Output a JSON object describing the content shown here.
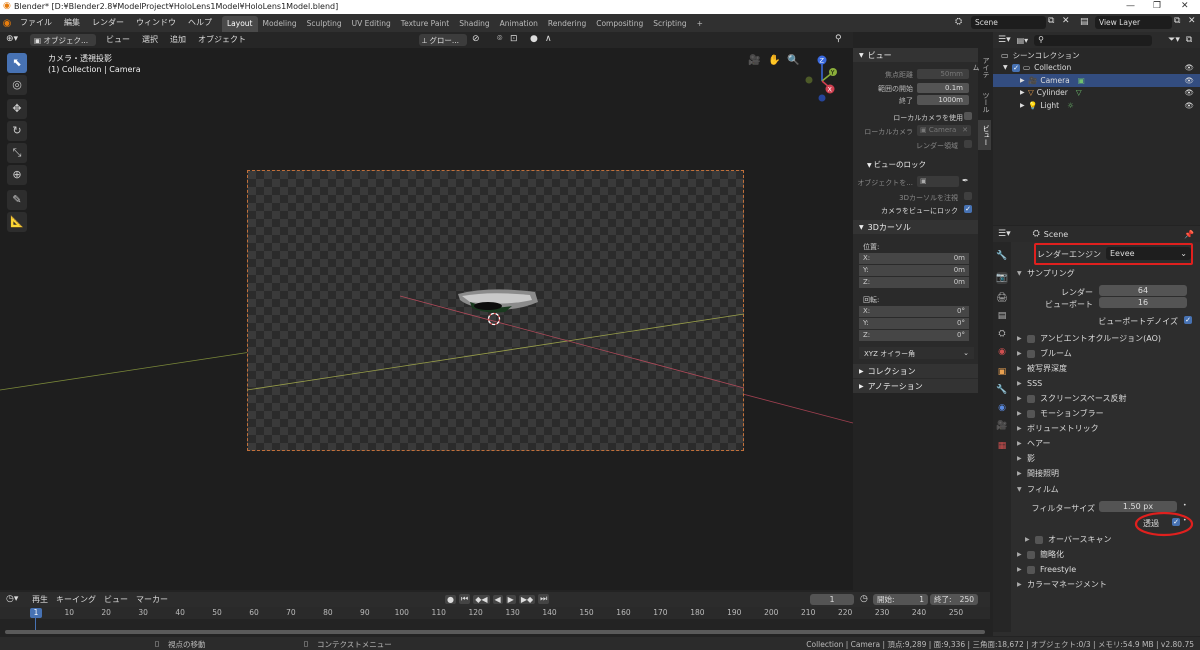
{
  "window": {
    "title": "Blender* [D:¥Blender2.8¥ModelProject¥HoloLens1Model¥HoloLens1Model.blend]"
  },
  "menubar": [
    "ファイル",
    "編集",
    "レンダー",
    "ウィンドウ",
    "ヘルプ"
  ],
  "workspaces": [
    "Layout",
    "Modeling",
    "Sculpting",
    "UV Editing",
    "Texture Paint",
    "Shading",
    "Animation",
    "Rendering",
    "Compositing",
    "Scripting",
    "+"
  ],
  "scene": {
    "name": "Scene",
    "view_layer": "View Layer"
  },
  "viewport_header": {
    "mode": "オブジェク...",
    "menus": [
      "ビュー",
      "選択",
      "追加",
      "オブジェクト"
    ],
    "orientation": "グロー..."
  },
  "viewport": {
    "overlay_line1": "カメラ・透視投影",
    "overlay_line2": "(1) Collection | Camera"
  },
  "npanel": {
    "view_title": "ビュー",
    "focal_label": "焦点距離",
    "focal_value": "50mm",
    "clip_start_label": "範囲の開始",
    "clip_start_value": "0.1m",
    "clip_end_label": "終了",
    "clip_end_value": "1000m",
    "local_camera_use": "ローカルカメラを使用",
    "local_camera_label": "ローカルカメラ",
    "local_camera_value": "Camera",
    "render_region": "レンダー領域",
    "view_lock_title": "ビューのロック",
    "lock_object_label": "オブジェクトを...",
    "lock_3d_cursor": "3Dカーソルを注視",
    "lock_camera_to_view": "カメラをビューにロック",
    "cursor_title": "3Dカーソル",
    "location_label": "位置:",
    "loc": [
      {
        "axis": "X:",
        "value": "0m"
      },
      {
        "axis": "Y:",
        "value": "0m"
      },
      {
        "axis": "Z:",
        "value": "0m"
      }
    ],
    "rotation_label": "回転:",
    "rot": [
      {
        "axis": "X:",
        "value": "0°"
      },
      {
        "axis": "Y:",
        "value": "0°"
      },
      {
        "axis": "Z:",
        "value": "0°"
      }
    ],
    "rotation_mode": "XYZ オイラー角",
    "collection_title": "コレクション",
    "annotation_title": "アノテーション"
  },
  "vtabs": [
    "アイテム",
    "ツール",
    "ビュー"
  ],
  "outliner": {
    "root": "シーンコレクション",
    "collection": "Collection",
    "items": [
      "Camera",
      "Cylinder",
      "Light"
    ]
  },
  "properties": {
    "context": "Scene",
    "render_engine_label": "レンダーエンジン",
    "render_engine_value": "Eevee",
    "sampling_title": "サンプリング",
    "render_label": "レンダー",
    "render_value": "64",
    "viewport_label": "ビューポート",
    "viewport_value": "16",
    "viewport_denoise": "ビューポートデノイズ",
    "sections": [
      "アンビエントオクルージョン(AO)",
      "ブルーム",
      "被写界深度",
      "SSS",
      "スクリーンスペース反射",
      "モーションブラー",
      "ボリューメトリック",
      "ヘアー",
      "影",
      "間接照明"
    ],
    "film_title": "フィルム",
    "filter_size_label": "フィルターサイズ",
    "filter_size_value": "1.50 px",
    "transparent_label": "透過",
    "overscan": "オーバースキャン",
    "simplify": "簡略化",
    "freestyle": "Freestyle",
    "color_management": "カラーマネージメント"
  },
  "timeline": {
    "menus": [
      "再生",
      "キーイング",
      "ビュー",
      "マーカー"
    ],
    "current_frame": "1",
    "start_label": "開始:",
    "start_value": "1",
    "end_label": "終了:",
    "end_value": "250",
    "ticks": [
      "1",
      "10",
      "20",
      "30",
      "40",
      "50",
      "60",
      "70",
      "80",
      "90",
      "100",
      "110",
      "120",
      "130",
      "140",
      "150",
      "160",
      "170",
      "180",
      "190",
      "200",
      "210",
      "220",
      "230",
      "240",
      "250"
    ]
  },
  "statusbar": {
    "left1": "視点の移動",
    "left2": "コンテクストメニュー",
    "right": "Collection | Camera | 頂点:9,289 | 面:9,336 | 三角面:18,672 | オブジェクト:0/3 | メモリ:54.9 MB | v2.80.75"
  },
  "colors": {
    "accent": "#4772b3",
    "highlight_red": "#e0201e",
    "camera_orange": "#c2703a"
  }
}
